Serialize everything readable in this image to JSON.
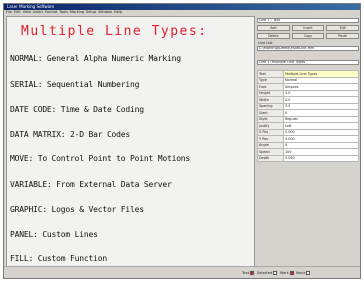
{
  "window": {
    "title": "Laser Marking Software",
    "accent": "#0a246a"
  },
  "menubar": [
    "File",
    "Edit",
    "View",
    "Insert",
    "Format",
    "Tools",
    "Marking",
    "Setup",
    "Window",
    "Help"
  ],
  "canvas": {
    "title": "Multiple Line Types:",
    "title_color": "#e0202a",
    "lines": [
      "NORMAL: General Alpha Numeric Marking",
      "SERIAL: Sequential Numbering",
      "DATE CODE: Time & Date Coding",
      "DATA MATRIX: 2-D Bar Codes",
      "MOVE: To Control Point to Point Motions",
      "VARIABLE: From External Data Server",
      "GRAPHIC: Logos & Vector Files",
      "PANEL: Custom Lines",
      "FILL: Custom Function"
    ]
  },
  "panel": {
    "file_field": "Line 1 - Text",
    "buttons_row1": [
      "Add",
      "Insert",
      "Edit"
    ],
    "buttons_row2": [
      "Delete",
      "Copy",
      "Paste"
    ],
    "list_label": "Line List",
    "path_field": "C:\\Marking\\Demo\\MultiLine.mrk",
    "type_select": "Line 1: Multiple Line Types",
    "properties": [
      {
        "key": "Text",
        "value": "Multiple Line Types"
      },
      {
        "key": "Type",
        "value": "Normal"
      },
      {
        "key": "Font",
        "value": "Simplex"
      },
      {
        "key": "Height",
        "value": "3.0"
      },
      {
        "key": "Width",
        "value": "2.0"
      },
      {
        "key": "Spacing",
        "value": "0.5"
      },
      {
        "key": "Slant",
        "value": "0"
      },
      {
        "key": "Style",
        "value": "Regular"
      },
      {
        "key": "Justify",
        "value": "Left"
      },
      {
        "key": "X Pos",
        "value": "0.000"
      },
      {
        "key": "Y Pos",
        "value": "0.000"
      },
      {
        "key": "Angle",
        "value": "0"
      },
      {
        "key": "Speed",
        "value": "100"
      },
      {
        "key": "Depth",
        "value": "0.050"
      }
    ]
  },
  "statusbar": {
    "legend": [
      {
        "label": "Text",
        "color": "#e0202a"
      },
      {
        "label": "Selected",
        "color": "#ffffff"
      },
      {
        "label": "Mark",
        "color": "#e0202a"
      },
      {
        "label": "Move",
        "color": "#ffffff"
      }
    ]
  }
}
